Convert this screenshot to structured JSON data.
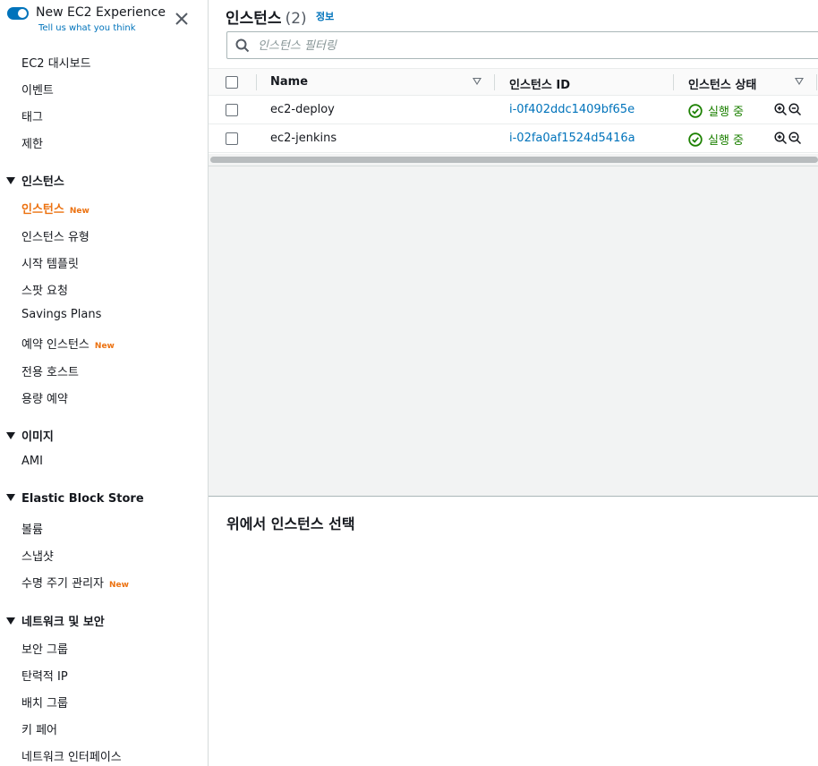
{
  "experience": {
    "title": "New EC2 Experience",
    "link": "Tell us what you think",
    "toggle_on": true
  },
  "sidebar": {
    "top_items": [
      {
        "label": "EC2 대시보드"
      },
      {
        "label": "이벤트"
      },
      {
        "label": "태그"
      },
      {
        "label": "제한"
      }
    ],
    "sections": [
      {
        "label": "인스턴스",
        "items": [
          {
            "label": "인스턴스",
            "badge": "New",
            "active": true
          },
          {
            "label": "인스턴스 유형"
          },
          {
            "label": "시작 템플릿"
          },
          {
            "label": "스팟 요청"
          },
          {
            "label": "Savings Plans"
          },
          {
            "label": "예약 인스턴스",
            "badge": "New"
          },
          {
            "label": "전용 호스트"
          },
          {
            "label": "용량 예약"
          }
        ]
      },
      {
        "label": "이미지",
        "items": [
          {
            "label": "AMI"
          }
        ]
      },
      {
        "label": "Elastic Block Store",
        "items": [
          {
            "label": "볼륨"
          },
          {
            "label": "스냅샷"
          },
          {
            "label": "수명 주기 관리자",
            "badge": "New"
          }
        ]
      },
      {
        "label": "네트워크 및 보안",
        "items": [
          {
            "label": "보안 그룹"
          },
          {
            "label": "탄력적 IP"
          },
          {
            "label": "배치 그룹"
          },
          {
            "label": "키 페어"
          },
          {
            "label": "네트워크 인터페이스"
          }
        ]
      }
    ]
  },
  "main": {
    "title": "인스턴스",
    "count": "(2)",
    "info_link": "정보",
    "search_placeholder": "인스턴스 필터링",
    "columns": [
      "Name",
      "인스턴스 ID",
      "인스턴스 상태"
    ],
    "rows": [
      {
        "name": "ec2-deploy",
        "id": "i-0f402ddc1409bf65e",
        "state": "실행 중"
      },
      {
        "name": "ec2-jenkins",
        "id": "i-02fa0af1524d5416a",
        "state": "실행 중"
      }
    ],
    "details_title": "위에서 인스턴스 선택"
  },
  "colors": {
    "accent": "#0073bb",
    "active_nav": "#ec7211",
    "running": "#1d8102"
  },
  "icons": {
    "close": "close-icon",
    "search": "search-icon",
    "caret": "caret-down-icon",
    "status": "check-circle-icon",
    "zoom_in": "zoom-in-icon",
    "zoom_out": "zoom-out-icon",
    "sort": "sort-icon"
  }
}
